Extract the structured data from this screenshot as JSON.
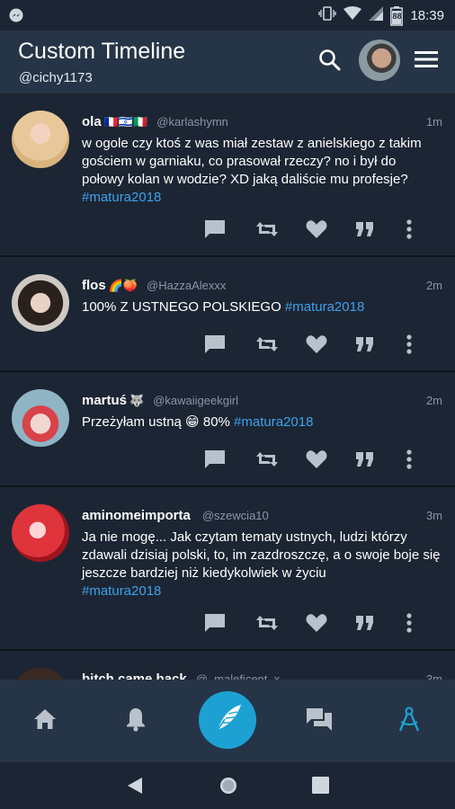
{
  "status_bar": {
    "time": "18:39",
    "battery": "88"
  },
  "app_bar": {
    "title": "Custom Timeline",
    "handle": "@cichy1173"
  },
  "colors": {
    "background": "#1c2533",
    "bar": "#263447",
    "accent": "#1da1d2",
    "hashtag": "#3ea1ec",
    "muted": "#8896a6"
  },
  "tweets": [
    {
      "name": "ola",
      "emoji": "🇫🇷🇮🇱🇮🇹",
      "username": "@karlashymn",
      "time": "1m",
      "text": "w ogole czy ktoś z was miał zestaw z anielskiego z takim gościem w garniaku, co prasował rzeczy? no i był do połowy kolan w wodzie? XD jaką daliście mu profesje?",
      "hashtag": "#matura2018"
    },
    {
      "name": "flos",
      "emoji": "🌈🍑",
      "username": "@HazzaAlexxx",
      "time": "2m",
      "text": "100% Z USTNEGO POLSKIEGO",
      "hashtag": "#matura2018"
    },
    {
      "name": "martuś",
      "emoji": "🐺",
      "username": "@kawaiigeekgirl",
      "time": "2m",
      "text": "Przeżyłam ustną 😁 80%",
      "hashtag": "#matura2018"
    },
    {
      "name": "aminomeimporta",
      "emoji": "",
      "username": "@szewcia10",
      "time": "3m",
      "text": "Ja nie mogę... Jak czytam tematy ustnych, ludzi którzy zdawali dzisiaj polski, to, im zazdroszczę, a o swoje boje się jeszcze bardziej niż kiedykolwiek w życiu",
      "hashtag": "#matura2018"
    },
    {
      "name": "bitch came back",
      "emoji": "",
      "username": "@_maleficent_x",
      "time": "3m",
      "text": "",
      "hashtag": ""
    }
  ],
  "icons": {
    "actions": [
      "reply-icon",
      "retweet-icon",
      "like-icon",
      "quote-icon",
      "more-icon"
    ],
    "bottom_nav": [
      "home-icon",
      "notifications-icon",
      "compose-icon",
      "messages-icon",
      "custom-timeline-icon"
    ],
    "system_nav": [
      "back-icon",
      "home-circle-icon",
      "recents-icon"
    ]
  }
}
